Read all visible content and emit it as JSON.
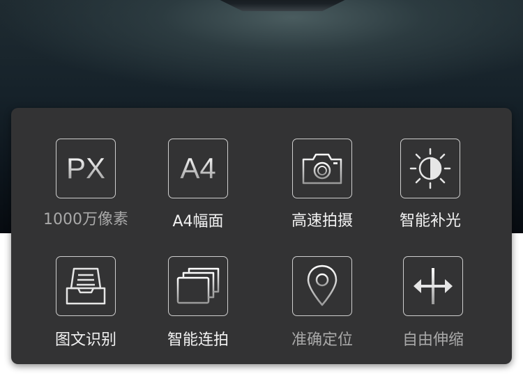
{
  "features": [
    {
      "icon": "px-icon",
      "icon_text": "PX",
      "label": "1000万像素"
    },
    {
      "icon": "a4-icon",
      "icon_text": "A4",
      "label": "A4幅面"
    },
    {
      "icon": "camera-icon",
      "label": "高速拍摄"
    },
    {
      "icon": "brightness-icon",
      "label": "智能补光"
    },
    {
      "icon": "document-tray-icon",
      "label": "图文识别"
    },
    {
      "icon": "stacked-photos-icon",
      "label": "智能连拍"
    },
    {
      "icon": "location-pin-icon",
      "label": "准确定位"
    },
    {
      "icon": "stretch-arrows-icon",
      "label": "自由伸缩"
    }
  ],
  "colors": {
    "panel": "#333334",
    "icon_border": "#cfcfcf",
    "label_bright": "#f2f2f2",
    "label_dim": "#a9a9a9"
  }
}
